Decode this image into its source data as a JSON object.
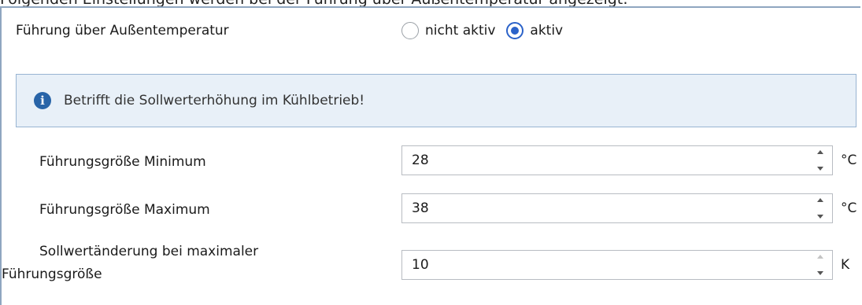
{
  "top_caption": "Folgenden Einstellungen werden bei der Führung über Außentemperatur angezeigt:",
  "guidance": {
    "label": "Führung über Außentemperatur",
    "options": [
      {
        "label": "nicht aktiv",
        "selected": false
      },
      {
        "label": "aktiv",
        "selected": true
      }
    ]
  },
  "info": {
    "icon": "info-icon",
    "text": "Betrifft die Sollwerterhöhung im Kühlbetrieb!"
  },
  "fields": [
    {
      "label": "Führungsgröße Minimum",
      "value": "28",
      "unit": "°C"
    },
    {
      "label": "Führungsgröße Maximum",
      "value": "38",
      "unit": "°C"
    },
    {
      "label_line1": "Sollwertänderung bei maximaler",
      "label_line2": "Führungsgröße",
      "value": "10",
      "unit": "K"
    }
  ],
  "colors": {
    "accent": "#2b62c9",
    "info_bg": "#e8f0f8",
    "info_icon": "#2864a8"
  }
}
